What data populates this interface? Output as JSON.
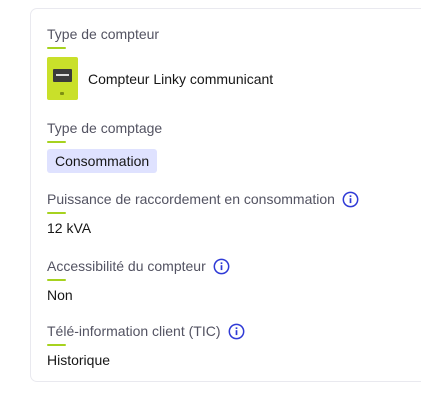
{
  "meter_type": {
    "label": "Type de compteur",
    "value": "Compteur Linky communicant",
    "icon": "linky-meter-icon"
  },
  "metering_type": {
    "label": "Type de comptage",
    "value": "Consommation"
  },
  "connection_power": {
    "label": "Puissance de raccordement en consommation",
    "value": "12 kVA",
    "icon": "info-icon"
  },
  "meter_accessibility": {
    "label": "Accessibilité du compteur",
    "value": "Non",
    "icon": "info-icon"
  },
  "tic": {
    "label": "Télé-information client (TIC)",
    "value": "Historique",
    "icon": "info-icon"
  },
  "colors": {
    "accent": "#a6d21f",
    "info_blue": "#2f3ad6",
    "badge_bg": "#dfe2ff",
    "meter_green": "#c9e02a"
  }
}
